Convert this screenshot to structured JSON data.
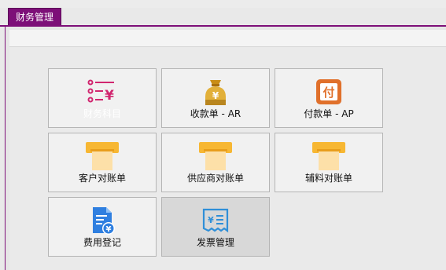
{
  "window": {
    "tab_label": "财务管理"
  },
  "tiles": [
    {
      "label": "财务科目",
      "icon": "list-yen-icon"
    },
    {
      "label": "收款单 - AR",
      "icon": "money-bag-icon"
    },
    {
      "label": "付款单 - AP",
      "icon": "pay-stamp-icon"
    },
    {
      "label": "客户对账单",
      "icon": "receipt-printer-icon"
    },
    {
      "label": "供应商对账单",
      "icon": "receipt-printer-icon"
    },
    {
      "label": "辅料对账单",
      "icon": "receipt-printer-icon"
    },
    {
      "label": "费用登记",
      "icon": "expense-document-icon"
    },
    {
      "label": "发票管理",
      "icon": "invoice-icon"
    }
  ],
  "icon_glyphs": {
    "list": "¥",
    "bag": "¥",
    "pay": "付",
    "invoice": "¥≡"
  },
  "colors": {
    "accent": "#7d0f78",
    "list_icon": "#d1266f",
    "bag": "#d8a52c",
    "pay": "#e0702b",
    "receipt": "#f7b733",
    "doc_blue": "#2f7fe0"
  }
}
